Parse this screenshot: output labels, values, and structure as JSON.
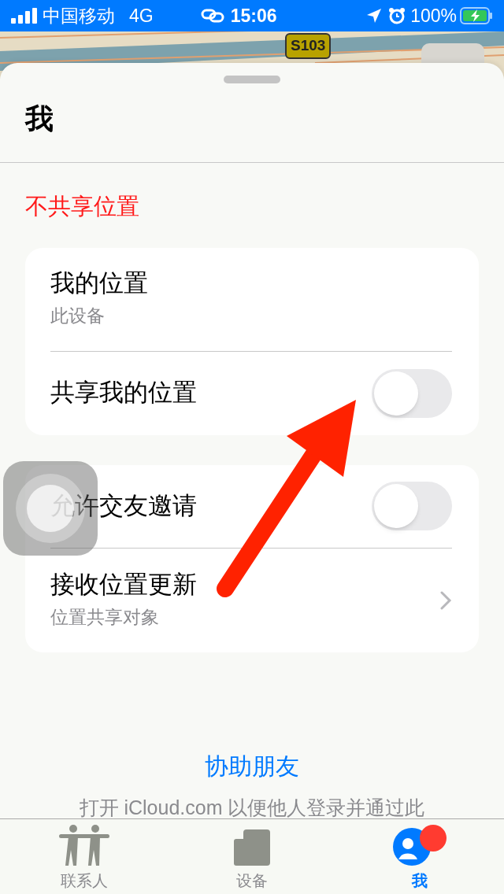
{
  "status_bar": {
    "carrier": "中国移动",
    "network": "4G",
    "time": "15:06",
    "battery": "100%"
  },
  "map": {
    "road_badge": "S103"
  },
  "sheet": {
    "title": "我",
    "section_header": "不共享位置",
    "groups": [
      {
        "rows": [
          {
            "kind": "info",
            "title": "我的位置",
            "subtitle": "此设备"
          },
          {
            "kind": "toggle",
            "title": "共享我的位置",
            "on": false
          }
        ]
      },
      {
        "rows": [
          {
            "kind": "toggle",
            "title": "允许交友邀请",
            "on": false
          },
          {
            "kind": "link",
            "title": "接收位置更新",
            "subtitle": "位置共享对象"
          }
        ]
      }
    ],
    "help_link": "协助朋友",
    "help_text": "打开 iCloud.com 以便他人登录并通过此"
  },
  "tab_bar": [
    {
      "label": "联系人",
      "kind": "people",
      "selected": false
    },
    {
      "label": "设备",
      "kind": "devices",
      "selected": false
    },
    {
      "label": "我",
      "kind": "me",
      "selected": true
    }
  ]
}
